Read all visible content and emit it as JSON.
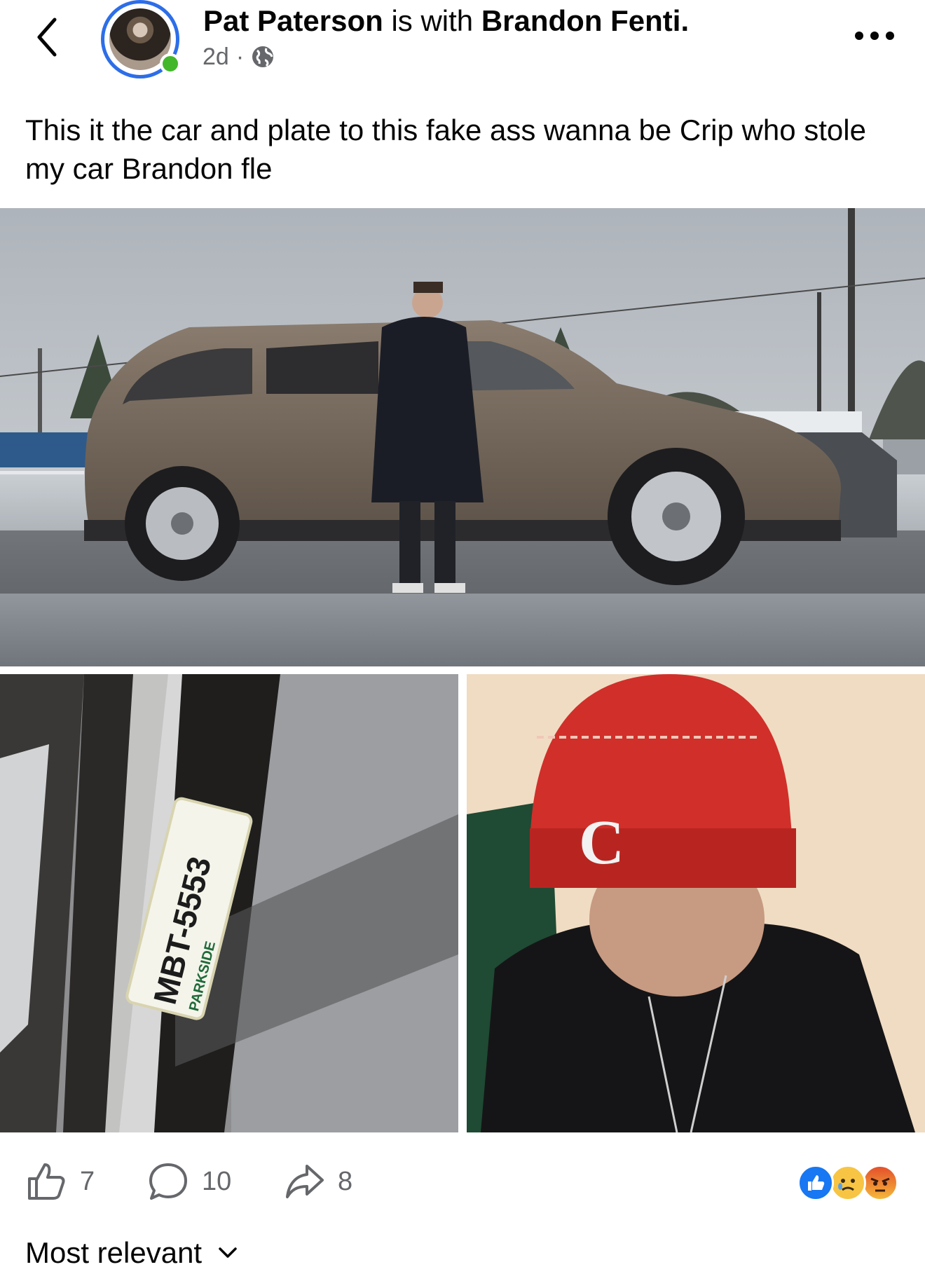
{
  "header": {
    "author": "Pat Paterson",
    "connector": "is with",
    "tagged": "Brandon Fenti.",
    "time": "2d",
    "separator": "·",
    "privacy_icon": "globe-icon"
  },
  "post": {
    "text": "This it the car and plate to this fake ass wanna be Crip who stole my car Brandon fle"
  },
  "photos": {
    "plate_text": "MBT-5553",
    "plate_footer": "PARKSIDE"
  },
  "actions": {
    "like_count": "7",
    "comment_count": "10",
    "share_count": "8"
  },
  "reactions": [
    "like",
    "sad",
    "angry"
  ],
  "comments_sort": {
    "label": "Most relevant"
  },
  "colors": {
    "accent": "#2d6ee8",
    "online": "#42b72a",
    "secondary_text": "#65676b"
  }
}
